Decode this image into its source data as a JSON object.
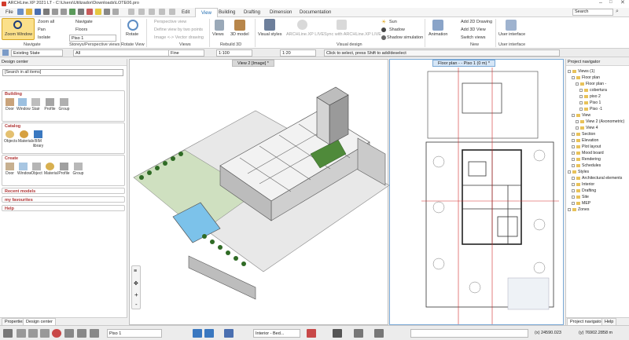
{
  "window": {
    "title": "ARCHLine.XP 2021  LT - C:\\Users\\Utilizador\\Downloads\\LOTE06.pro"
  },
  "tabs": [
    "File",
    "Edit",
    "View",
    "Building",
    "Drafting",
    "Dimension",
    "Documentation"
  ],
  "active_tab": "View",
  "search_label": "Search",
  "ribbon": {
    "navigate": {
      "zoom_window": "Zoom Window",
      "zoom_all": "Zoom all",
      "pan": "Pan",
      "isolate": "Isolate",
      "navigate": "Navigate",
      "floors": "Floors",
      "floor_value": "Piso 1",
      "group_label": "Navigate",
      "group_label2": "Storeys/Perspective views"
    },
    "rotate": {
      "label": "Rotate",
      "group_label": "Rotate View"
    },
    "views": {
      "perspective": "Perspective view",
      "define_two_points": "Define view by two points",
      "image_vector": "Image <-> Vector drawing",
      "group_label": "Views"
    },
    "rebuild": {
      "model": "3D model",
      "views": "Views",
      "group_label": "Rebuild 3D"
    },
    "visual": {
      "visual_styles": "Visual styles",
      "live": "ARCHLine.XP LIVE",
      "sync_live": "Sync with ARCHLine.XP LIVE",
      "sun": "Sun",
      "shadow": "Shadow",
      "shadow_sim": "Shadow simulation",
      "group_label": "Visual design"
    },
    "new": {
      "animation": "Animation",
      "add_2d": "Add 2D Drawing",
      "add_3d": "Add 3D View",
      "switch_views": "Switch views",
      "group_label": "New"
    },
    "ui": {
      "label": "User interface",
      "group_label": "User interface"
    }
  },
  "toolbar2": {
    "layer": "Existing State",
    "filter": "All",
    "line": "Fine",
    "scale": "1:100",
    "scale2": "1:20",
    "hint": "Click to select, press Shift to add/deselect"
  },
  "left_panel": {
    "title": "Design center",
    "search_placeholder": "[Search in all items]",
    "building": {
      "header": "Building",
      "tools": [
        "Door",
        "Window",
        "Stair",
        "Profile",
        "Group"
      ]
    },
    "catalog": {
      "header": "Catalog",
      "tools": [
        "Objects",
        "Materials",
        "BIM library"
      ]
    },
    "create": {
      "header": "Create",
      "tools": [
        "Door",
        "Window",
        "Object",
        "Material",
        "Profile",
        "Group"
      ]
    },
    "recent": "Recent models",
    "favourites": "my favourites",
    "help": "Help",
    "bottom_tabs": [
      "Properties",
      "Design center"
    ]
  },
  "view1": {
    "tab": "View 2 [Image] *"
  },
  "view2": {
    "tab": "Floor plan - - Piso 1 (0 m) *"
  },
  "navigator": {
    "title": "Project navigator",
    "items": [
      {
        "label": "Views (1)",
        "indent": 0
      },
      {
        "label": "Floor plan",
        "indent": 1
      },
      {
        "label": "Floor plan -",
        "indent": 2
      },
      {
        "label": "cobertura",
        "indent": 3
      },
      {
        "label": "piso 2",
        "indent": 3
      },
      {
        "label": "Piso 1",
        "indent": 3
      },
      {
        "label": "Piso -1",
        "indent": 3
      },
      {
        "label": "View",
        "indent": 1
      },
      {
        "label": "View 2 (Axonometric)",
        "indent": 2
      },
      {
        "label": "View 4",
        "indent": 2
      },
      {
        "label": "Section",
        "indent": 1
      },
      {
        "label": "Elevation",
        "indent": 1
      },
      {
        "label": "Plot layout",
        "indent": 1
      },
      {
        "label": "Mood board",
        "indent": 1
      },
      {
        "label": "Rendering",
        "indent": 1
      },
      {
        "label": "Schedules",
        "indent": 1
      },
      {
        "label": "Styles",
        "indent": 0
      },
      {
        "label": "Architectural elements",
        "indent": 1
      },
      {
        "label": "Interior",
        "indent": 1
      },
      {
        "label": "Drafting",
        "indent": 1
      },
      {
        "label": "Site",
        "indent": 1
      },
      {
        "label": "MEP",
        "indent": 1
      },
      {
        "label": "Zones",
        "indent": 0
      }
    ],
    "bottom_tabs": [
      "Project navigator",
      "Help"
    ]
  },
  "statusbar": {
    "floor": "Piso 1",
    "interior": "Interior - Bed...",
    "x": "(x) 24590.023",
    "y": "(y) 76902.2858 m"
  }
}
